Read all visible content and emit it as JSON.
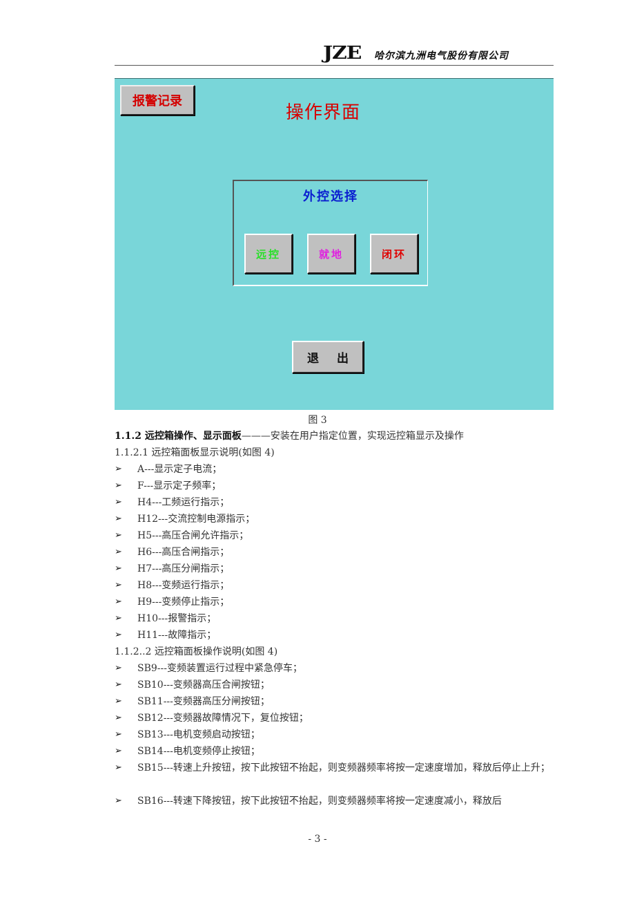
{
  "header": {
    "logo": "JZE",
    "company": "哈尔滨九洲电气股份有限公司"
  },
  "hmi": {
    "background_color": "#79d6d9",
    "alarm_button": "报警记录",
    "title": "操作界面",
    "group_title": "外控选择",
    "buttons": [
      {
        "label": "远控",
        "color": "#28e028"
      },
      {
        "label": "就地",
        "color": "#e020e0"
      },
      {
        "label": "闭环",
        "color": "#e00000"
      }
    ],
    "exit_button": "退 出"
  },
  "document": {
    "figure_caption": "图 3",
    "section_title_bold": "1.1.2 远控箱操作、显示面板",
    "section_title_rest": "———安装在用户指定位置，实现远控箱显示及操作",
    "subsection1": "1.1.2.1 远控箱面板显示说明(如图 4)",
    "display_items": [
      "A---显示定子电流；",
      "F---显示定子频率；",
      "H4---工频运行指示；",
      "H12---交流控制电源指示；",
      "H5---高压合闸允许指示；",
      "H6---高压合闸指示；",
      "H7---高压分闸指示；",
      "H8---变频运行指示；",
      "H9---变频停止指示；",
      "H10---报警指示；",
      "H11---故障指示；"
    ],
    "subsection2": "1.1.2..2 远控箱面板操作说明(如图 4)",
    "operation_items": [
      "SB9---变频装置运行过程中紧急停车；",
      "SB10---变频器高压合闸按钮；",
      "SB11---变频器高压分闸按钮；",
      "SB12---变频器故障情况下，复位按钮；",
      "SB13---电机变频启动按钮；",
      "SB14---电机变频停止按钮；",
      "SB15---转速上升按钮，按下此按钮不抬起，则变频器频率将按一定速度增加，释放后停止上升；",
      "SB16---转速下降按钮，按下此按钮不抬起，则变频器频率将按一定速度减小，释放后"
    ],
    "bullet_glyph": "➢",
    "page_number": "- 3 -"
  }
}
